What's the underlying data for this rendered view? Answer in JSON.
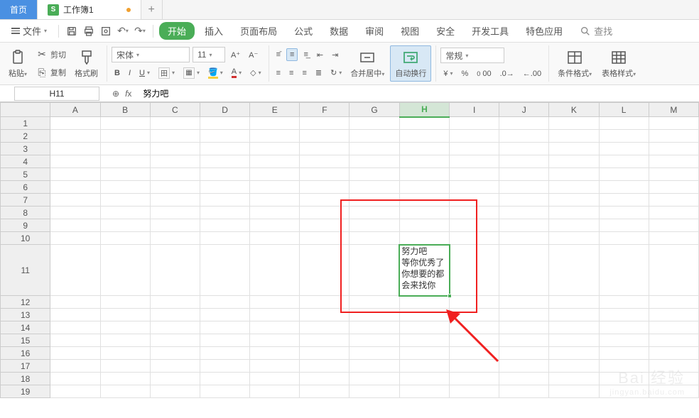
{
  "tabs": {
    "home": "首页",
    "doc_icon": "S",
    "doc_name": "工作簿1",
    "add": "+"
  },
  "menu": {
    "file": "文件",
    "items": [
      "开始",
      "插入",
      "页面布局",
      "公式",
      "数据",
      "审阅",
      "视图",
      "安全",
      "开发工具",
      "特色应用"
    ],
    "search": "查找"
  },
  "ribbon": {
    "paste": "粘贴",
    "cut": "剪切",
    "copy": "复制",
    "format_painter": "格式刷",
    "font_name": "宋体",
    "font_size": "11",
    "merge": "合并居中",
    "wrap": "自动换行",
    "number_format": "常规",
    "cond_format": "条件格式",
    "table_style": "表格样式"
  },
  "cell_ref": "H11",
  "formula_value": "努力吧",
  "columns": [
    "A",
    "B",
    "C",
    "D",
    "E",
    "F",
    "G",
    "H",
    "I",
    "J",
    "K",
    "L",
    "M"
  ],
  "rows": [
    "1",
    "2",
    "3",
    "4",
    "5",
    "6",
    "7",
    "8",
    "9",
    "10",
    "11",
    "12",
    "13",
    "14",
    "15",
    "16",
    "17",
    "18",
    "19"
  ],
  "selected_cell_text": "努力吧\n等你优秀了\n你想要的都\n会来找你",
  "watermark": {
    "brand": "Bai",
    "brand2": "经验",
    "url": "jingyan.baidu.com"
  }
}
